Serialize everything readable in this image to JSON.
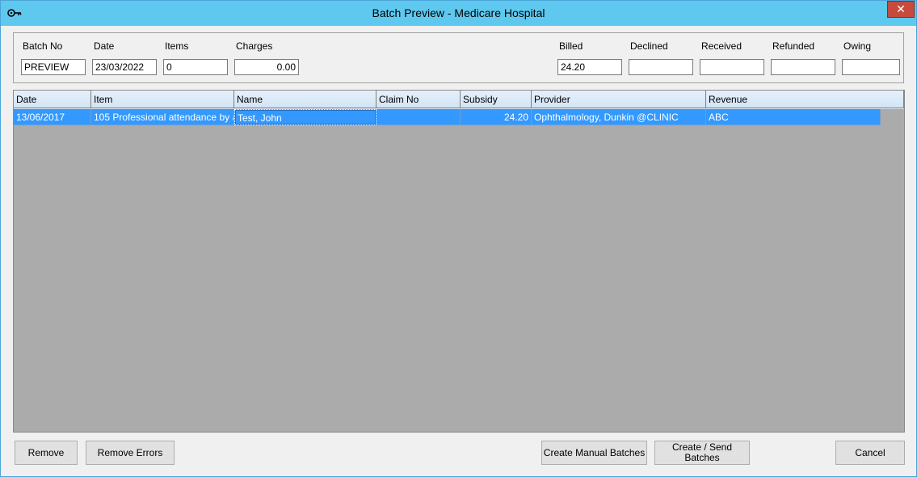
{
  "window": {
    "title": "Batch Preview - Medicare Hospital",
    "close_glyph": "✕"
  },
  "summary": {
    "batch_no": {
      "label": "Batch No",
      "value": "PREVIEW"
    },
    "date": {
      "label": "Date",
      "value": "23/03/2022"
    },
    "items": {
      "label": "Items",
      "value": "0"
    },
    "charges": {
      "label": "Charges",
      "value": "0.00"
    },
    "billed": {
      "label": "Billed",
      "value": "24.20"
    },
    "declined": {
      "label": "Declined",
      "value": ""
    },
    "received": {
      "label": "Received",
      "value": ""
    },
    "refunded": {
      "label": "Refunded",
      "value": ""
    },
    "owing": {
      "label": "Owing",
      "value": ""
    }
  },
  "grid": {
    "columns": [
      "Date",
      "Item",
      "Name",
      "Claim No",
      "Subsidy",
      "Provider",
      "Revenue"
    ],
    "rows": [
      {
        "date": "13/06/2017",
        "item": "105 Professional attendance by a sp",
        "name": "Test, John",
        "claim_no": "",
        "subsidy": "24.20",
        "provider": "Ophthalmology, Dunkin @CLINIC",
        "revenue": "ABC"
      }
    ]
  },
  "buttons": {
    "remove": "Remove",
    "remove_errors": "Remove Errors",
    "create_manual": "Create Manual Batches",
    "create_send_line1": "Create / Send",
    "create_send_line2": "Batches",
    "cancel": "Cancel"
  },
  "colors": {
    "titlebar": "#5ec8ee",
    "selection": "#3399ff",
    "grid_background": "#ababab",
    "close": "#c74a3d"
  }
}
